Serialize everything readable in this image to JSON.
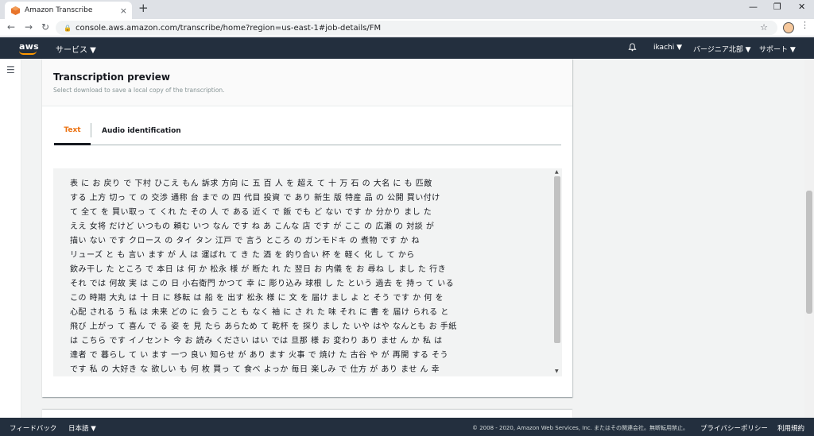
{
  "browser": {
    "tab_title": "Amazon Transcribe",
    "tab_close": "×",
    "new_tab": "+",
    "url": "console.aws.amazon.com/transcribe/home?region=us-east-1#job-details/FM",
    "back": "←",
    "forward": "→",
    "reload": "↻",
    "star": "☆",
    "minimize": "—",
    "restore": "❐",
    "close": "✕",
    "menu": "⋮"
  },
  "aws_header": {
    "logo": "aws",
    "services_label": "サービス ▼",
    "bell": "🔔",
    "user": "ikachi ▼",
    "region": "バージニア北部 ▼",
    "support": "サポート ▼"
  },
  "card": {
    "title": "Transcription preview",
    "description": "Select download to save a local copy of the transcription.",
    "tabs": [
      {
        "label": "Text",
        "active": true
      },
      {
        "label": "Audio identification",
        "active": false
      }
    ]
  },
  "transcript_lines": [
    "表 に お 戻り で 下村 ひこえ もん 訴求 方向 に 五 百 人 を 超え て 十 万 石 の 大名 に も 匹敵",
    "する 上方 切っ て の 交渉 通称 台 まで の 四 代目 投資 で あり 新生 版 特産 品 の 公開 買い付け",
    "て 全て を 買い取っ て くれ た その 人 で ある 近く で 飯 でも ど ない です か 分かり まし た",
    "ええ 女将 だけど いつもの 頼む いつ なん です ね あ こんな 店 です が ここ の 広瀬 の 対談 が",
    "描い ない です クロース の タイ タン 江戸 で 言う ところ の ガンモドキ の 煮物 です か ね",
    "リューズ と も 言い ます が 人 は 運ばれ て き た 酒 を 釣り合い 杯 を 軽く 化 し て から",
    "飲み干し た ところ で 本日 は 何 か 松永 様 が 断た れ た 翌日 お 内儀 を お 尋ね し まし た 行き",
    "それ では 何故 実 は この 日 小右衛門 かつて 幸 に 彫り込み 球根 し た という 過去 を 持っ て いる",
    "この 時期 大丸 は 十 日 に 移転 は 船 を 出す 松永 様 に 文 を 届け まし よ と そう です か 何 を",
    "心配 される う 私 は 未来 どの に 会う こと も なく 袖 に さ れ た 味 それ に 書 を 届け られる と",
    "飛び 上がっ て 喜ん で る 姿 を 見 たら あらため て 乾杯 を 探り まし た いや はや なんとも お 手紙",
    "は こちら です イノセント 今 お 読み ください はい では 旦那 様 お 変わり あり ませ ん か 私 は",
    "達者 で 暮らし て い ます 一つ 良い 知らせ が あり ます 火事 で 焼け た 古谷 や が 再開 する そう",
    "です 私 の 大好き な 欲しい も 何 枚 買っ て 食べ よっか 毎日 楽しみ で 仕方 が あり ませ ん 幸"
  ],
  "footer": {
    "feedback": "フィードバック",
    "language": "日本語 ▼",
    "copyright": "© 2008 - 2020, Amazon Web Services, Inc. またはその関連会社。無断転用禁止。",
    "privacy": "プライバシーポリシー",
    "terms": "利用規約"
  },
  "colors": {
    "aws_nav": "#232f3e",
    "active_tab_text": "#ec7211",
    "aws_orange": "#ff9900"
  }
}
